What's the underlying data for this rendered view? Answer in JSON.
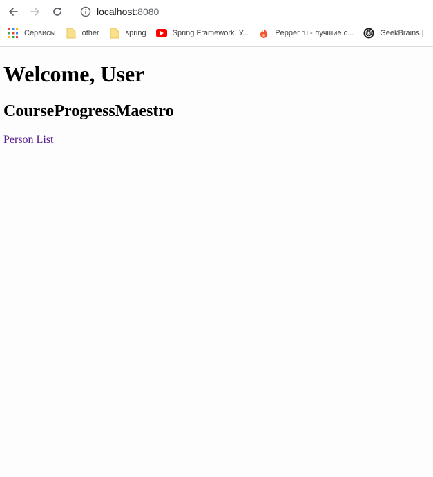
{
  "browser": {
    "url_host": "localhost",
    "url_port": ":8080",
    "bookmarks": [
      {
        "label": "Сервисы",
        "icon": "apps-grid-icon"
      },
      {
        "label": "other",
        "icon": "folder-icon"
      },
      {
        "label": "spring",
        "icon": "folder-icon"
      },
      {
        "label": "Spring Framework. У...",
        "icon": "youtube-icon"
      },
      {
        "label": "Pepper.ru - лучшие с...",
        "icon": "pepper-flame-icon"
      },
      {
        "label": "GeekBrains |",
        "icon": "geekbrains-icon"
      }
    ]
  },
  "page": {
    "heading": "Welcome, User",
    "subheading": "CourseProgressMaestro",
    "link_text": "Person List"
  },
  "colors": {
    "link_visited": "#551a8b",
    "folder": "#f6d365",
    "youtube": "#ff0000",
    "pepper": "#f2542d"
  }
}
